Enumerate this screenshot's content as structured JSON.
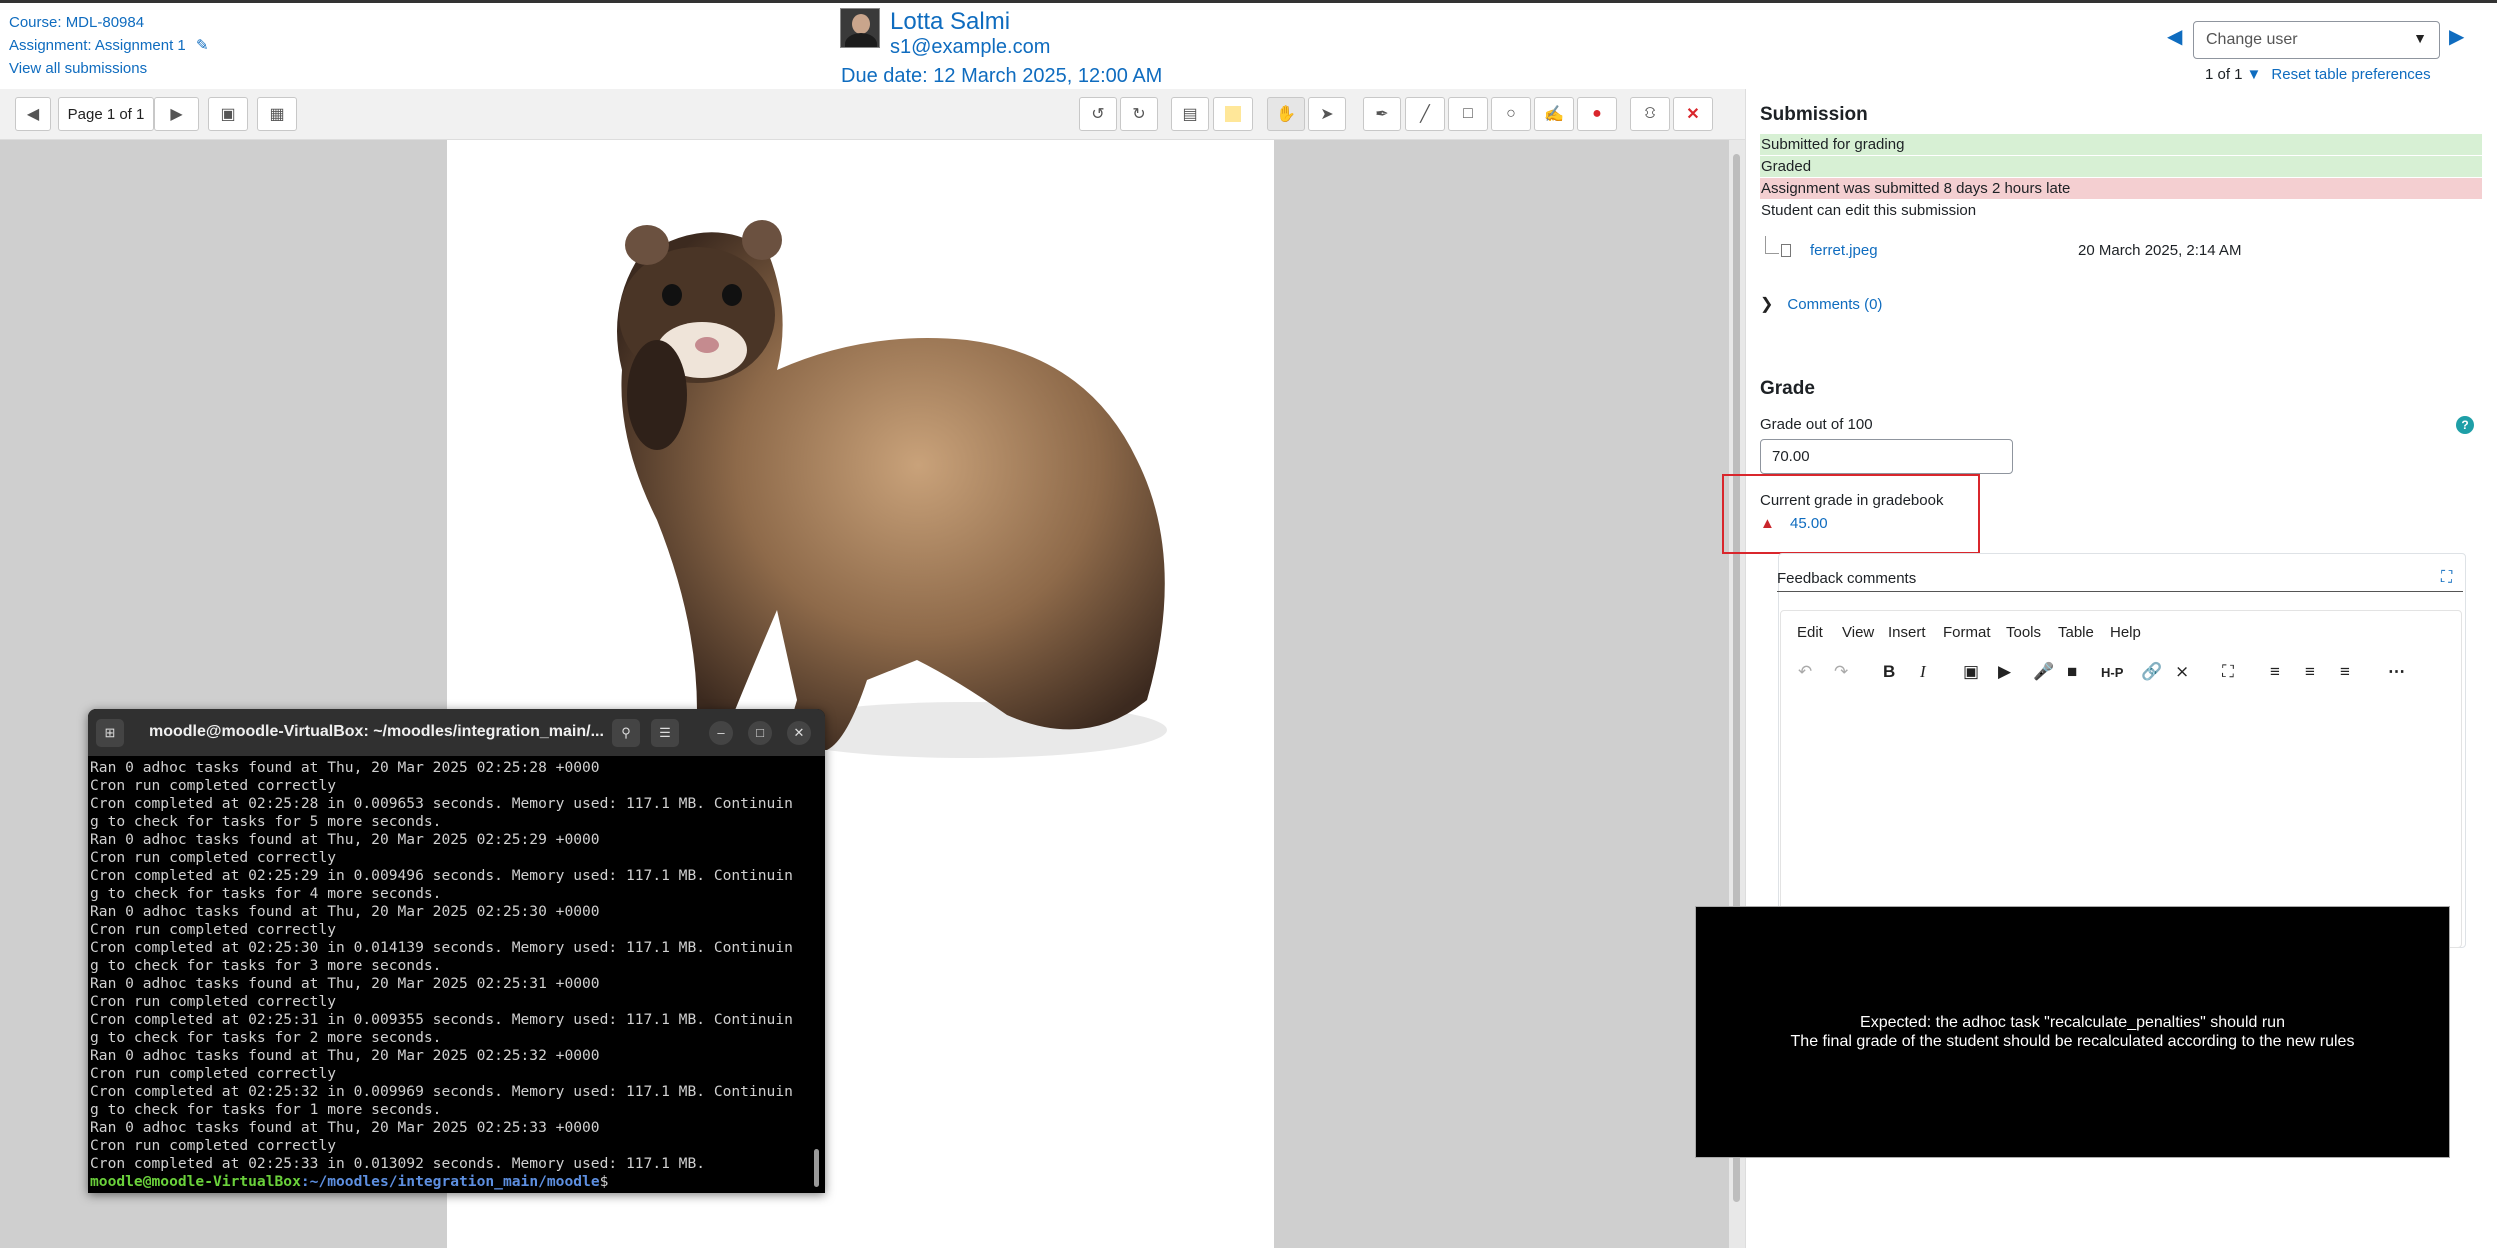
{
  "header": {
    "course": "Course: MDL-80984",
    "assignment": "Assignment: Assignment 1",
    "view_all": "View all submissions",
    "user_name": "Lotta Salmi",
    "user_email": "s1@example.com",
    "due_date": "Due date: 12 March 2025, 12:00 AM",
    "change_user": "Change user",
    "count": "1 of 1",
    "reset": "Reset table preferences"
  },
  "toolbar": {
    "page_label": "Page 1 of 1"
  },
  "submission": {
    "heading": "Submission",
    "statuses": [
      "Submitted for grading",
      "Graded",
      "Assignment was submitted 8 days 2 hours late",
      "Student can edit this submission"
    ],
    "file_name": "ferret.jpeg",
    "file_date": "20 March 2025, 2:14 AM",
    "comments": "Comments (0)"
  },
  "grade": {
    "heading": "Grade",
    "grade_out_label": "Grade out of 100",
    "grade_value": "70.00",
    "current_label": "Current grade in gradebook",
    "current_value": "45.00"
  },
  "feedback": {
    "label": "Feedback comments",
    "menus": [
      "Edit",
      "View",
      "Insert",
      "Format",
      "Tools",
      "Table",
      "Help"
    ]
  },
  "terminal": {
    "title": "moodle@moodle-VirtualBox: ~/moodles/integration_main/...",
    "lines": [
      "Ran 0 adhoc tasks found at Thu, 20 Mar 2025 02:25:28 +0000",
      "Cron run completed correctly",
      "Cron completed at 02:25:28 in 0.009653 seconds. Memory used: 117.1 MB. Continuin",
      "g to check for tasks for 5 more seconds.",
      "Ran 0 adhoc tasks found at Thu, 20 Mar 2025 02:25:29 +0000",
      "Cron run completed correctly",
      "Cron completed at 02:25:29 in 0.009496 seconds. Memory used: 117.1 MB. Continuin",
      "g to check for tasks for 4 more seconds.",
      "Ran 0 adhoc tasks found at Thu, 20 Mar 2025 02:25:30 +0000",
      "Cron run completed correctly",
      "Cron completed at 02:25:30 in 0.014139 seconds. Memory used: 117.1 MB. Continuin",
      "g to check for tasks for 3 more seconds.",
      "Ran 0 adhoc tasks found at Thu, 20 Mar 2025 02:25:31 +0000",
      "Cron run completed correctly",
      "Cron completed at 02:25:31 in 0.009355 seconds. Memory used: 117.1 MB. Continuin",
      "g to check for tasks for 2 more seconds.",
      "Ran 0 adhoc tasks found at Thu, 20 Mar 2025 02:25:32 +0000",
      "Cron run completed correctly",
      "Cron completed at 02:25:32 in 0.009969 seconds. Memory used: 117.1 MB. Continuin",
      "g to check for tasks for 1 more seconds.",
      "Ran 0 adhoc tasks found at Thu, 20 Mar 2025 02:25:33 +0000",
      "Cron run completed correctly",
      "Cron completed at 02:25:33 in 0.013092 seconds. Memory used: 117.1 MB."
    ],
    "prompt_user": "moodle@moodle-VirtualBox",
    "prompt_path": ":~/moodles/integration_main/moodle",
    "prompt_end": "$"
  },
  "caption": {
    "line1": "Expected: the adhoc task \"recalculate_penalties\" should run",
    "line2": "The final grade of the student should be recalculated according to the new rules"
  },
  "colors": {
    "link": "#0f6cbf",
    "success_bg": "#d7f0d4",
    "danger_bg": "#f4cfd1",
    "highlight_border": "#d9262c"
  }
}
